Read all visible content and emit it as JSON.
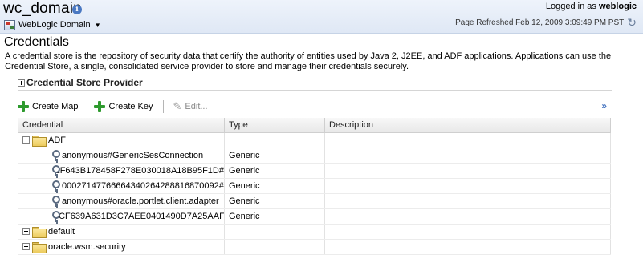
{
  "header": {
    "domain_title": "wc_domain",
    "domain_menu_label": "WebLogic Domain",
    "logged_in_prefix": "Logged in as",
    "logged_in_user": "weblogic",
    "page_refreshed": "Page Refreshed Feb 12, 2009 3:09:49 PM PST"
  },
  "section": {
    "title": "Credentials",
    "description": "A credential store is the repository of security data that certify the authority of entities used by Java 2, J2EE, and ADF applications. Applications can use the Credential Store, a single, consolidated service provider to store and manage their credentials securely.",
    "provider_label": "Credential Store Provider"
  },
  "toolbar": {
    "create_map_label": "Create Map",
    "create_key_label": "Create Key",
    "edit_label": "Edit..."
  },
  "table": {
    "columns": [
      "Credential",
      "Type",
      "Description"
    ],
    "rows": [
      {
        "kind": "map",
        "expanded": true,
        "name": "ADF",
        "type": "",
        "description": ""
      },
      {
        "kind": "key",
        "name": "anonymous#GenericSesConnection",
        "type": "Generic",
        "description": ""
      },
      {
        "kind": "key",
        "name": "EF643B178458F278E030018A18B95F1D#",
        "type": "Generic",
        "description": ""
      },
      {
        "kind": "key",
        "name": "00027147766664340264288816870092#",
        "type": "Generic",
        "description": ""
      },
      {
        "kind": "key",
        "name": "anonymous#oracle.portlet.client.adapter",
        "type": "Generic",
        "description": ""
      },
      {
        "kind": "key",
        "name": "5CF639A631D3C7AEE0401490D7A25AAF",
        "type": "Generic",
        "description": ""
      },
      {
        "kind": "map",
        "expanded": false,
        "name": "default",
        "type": "",
        "description": ""
      },
      {
        "kind": "map",
        "expanded": false,
        "name": "oracle.wsm.security",
        "type": "",
        "description": ""
      }
    ]
  },
  "icons": {
    "info": "info-icon",
    "domain_menu": "weblogic-domain-icon",
    "refresh": "refresh-icon",
    "create": "plus-icon",
    "edit": "pencil-icon",
    "more": "double-chevron-right-icon",
    "map": "folder-icon",
    "key": "key-icon"
  },
  "colors": {
    "header_bg": "#dfe8f5",
    "accent": "#4a78c2",
    "create_green": "#2e9a2e"
  }
}
